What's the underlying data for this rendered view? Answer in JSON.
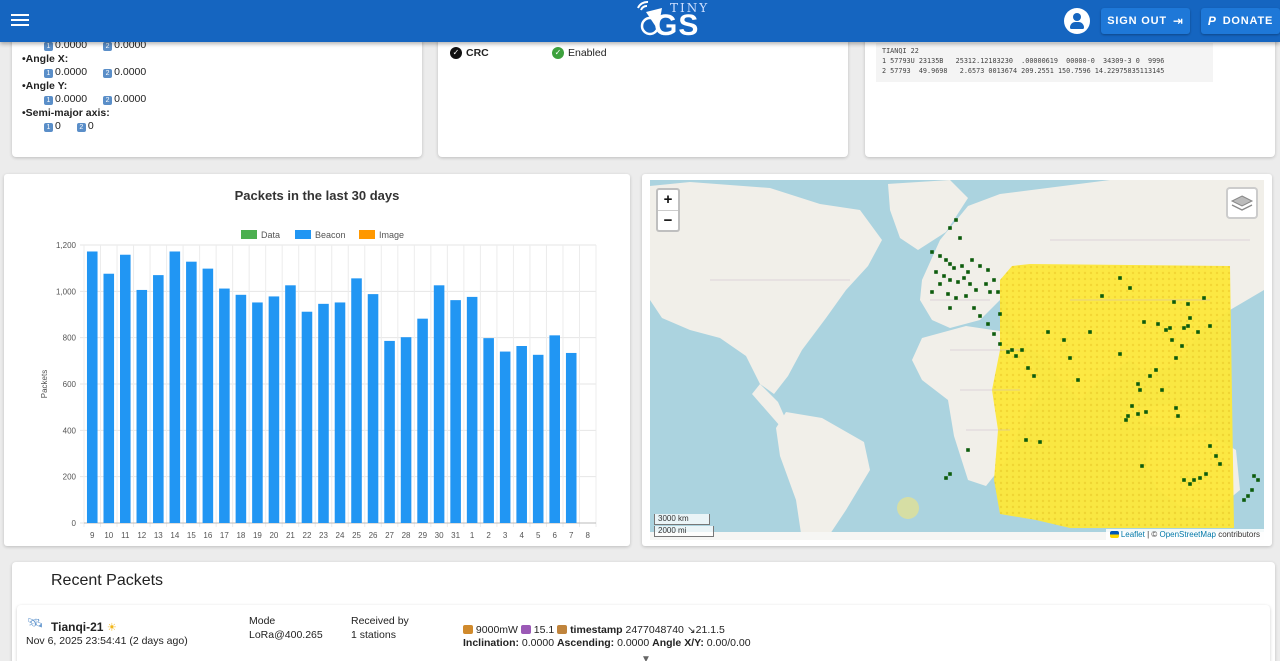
{
  "header": {
    "logo_top": "TINY",
    "logo_main": "GS",
    "signout_label": "SIGN OUT",
    "donate_label": "DONATE"
  },
  "params": {
    "row0": {
      "v1": "0.0000",
      "v2": "0.0000"
    },
    "angle_x": {
      "title": "•Angle X:",
      "v1": "0.0000",
      "v2": "0.0000"
    },
    "angle_y": {
      "title": "•Angle Y:",
      "v1": "0.0000",
      "v2": "0.0000"
    },
    "semi_major": {
      "title": "•Semi-major axis:",
      "v1": "0",
      "v2": "0"
    },
    "badge1": "1",
    "badge2": "2"
  },
  "config": {
    "crc_label": "CRC",
    "crc_value": "Enabled"
  },
  "tle": {
    "name": "TIANQI 22",
    "line1": "1 57793U 23135B   25312.12183230  .00000619  00000-0  34309-3 0  9996",
    "line2": "2 57793  49.9698   2.6573 0013674 209.2551 150.7596 14.22975835113145"
  },
  "chart_data": {
    "type": "bar",
    "title": "Packets in the last 30 days",
    "ylabel": "Packets",
    "xlabel": "",
    "ylim": [
      0,
      1200
    ],
    "yticks": [
      0,
      200,
      400,
      600,
      800,
      1000,
      1200
    ],
    "ytick_labels": [
      "0",
      "200",
      "400",
      "600",
      "800",
      "1,000",
      "1,200"
    ],
    "categories": [
      "9",
      "10",
      "11",
      "12",
      "13",
      "14",
      "15",
      "16",
      "17",
      "18",
      "19",
      "20",
      "21",
      "22",
      "23",
      "24",
      "25",
      "26",
      "27",
      "28",
      "29",
      "30",
      "31",
      "1",
      "2",
      "3",
      "4",
      "5",
      "6",
      "7",
      "8"
    ],
    "legend": [
      "Data",
      "Beacon",
      "Image"
    ],
    "legend_colors": [
      "#4caf50",
      "#2196f3",
      "#ff9800"
    ],
    "series": [
      {
        "name": "Beacon",
        "values": [
          1172,
          1076,
          1158,
          1006,
          1070,
          1172,
          1128,
          1098,
          1012,
          985,
          952,
          978,
          1026,
          912,
          946,
          952,
          1056,
          988,
          786,
          802,
          882,
          1026,
          962,
          976,
          798,
          740,
          764,
          726,
          810,
          734,
          0
        ]
      }
    ]
  },
  "map": {
    "zoom_in": "+",
    "zoom_out": "−",
    "scale_km": "3000 km",
    "scale_mi": "2000 mi",
    "attrib_leaflet": "Leaflet",
    "attrib_sep": " | © ",
    "attrib_osm": "OpenStreetMap",
    "attrib_tail": " contributors"
  },
  "recent": {
    "title": "Recent Packets",
    "packet": {
      "name": "Tianqi-21",
      "date": "Nov 6, 2025 23:54:41 (2 days ago)",
      "mode_label": "Mode",
      "mode_value": "LoRa@400.265",
      "recv_label": "Received by",
      "recv_value": "1 stations",
      "power": "9000mW",
      "tag2": "15.1",
      "ts_label": "timestamp",
      "ts_value": "2477048740",
      "ver": "21.1.5",
      "incl_label": "Inclination:",
      "incl_value": "0.0000",
      "asc_label": "Ascending:",
      "asc_value": "0.0000",
      "angle_label": "Angle X/Y:",
      "angle_value": "0.00/0.00"
    }
  }
}
